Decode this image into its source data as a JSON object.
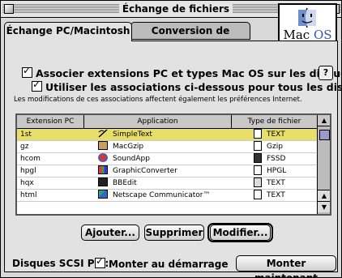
{
  "window": {
    "title": "Échange de fichiers"
  },
  "logo": {
    "text_mac": "Mac",
    "text_os": "OS"
  },
  "tabs": [
    {
      "label": "Échange PC/Macintosh",
      "active": true
    },
    {
      "label": "Conversion de fichiers",
      "active": false
    }
  ],
  "options": {
    "assoc_label": "Associer extensions PC et types Mac OS sur les disques PC",
    "assoc_checked": true,
    "use_label": "Utiliser les associations ci-dessous pour tous les disques",
    "use_checked": true,
    "help_label": "?"
  },
  "info_text": "Les modifications de ces associations affectent également les préférences Internet.",
  "table": {
    "columns": [
      "Extension PC",
      "Application",
      "Type de fichier"
    ],
    "rows": [
      {
        "ext": "1st",
        "app": "SimpleText",
        "type": "TEXT",
        "app_icon": "simpletext-icon",
        "type_icon": "text-document-icon",
        "selected": true
      },
      {
        "ext": "gz",
        "app": "MacGzip",
        "type": "Gzip",
        "app_icon": "macgzip-icon",
        "type_icon": "blank-document-icon",
        "selected": false
      },
      {
        "ext": "hcom",
        "app": "SoundApp",
        "type": "FSSD",
        "app_icon": "soundapp-icon",
        "type_icon": "sound-document-icon",
        "selected": false
      },
      {
        "ext": "hpgl",
        "app": "GraphicConverter",
        "type": "HPGL",
        "app_icon": "graphicconverter-icon",
        "type_icon": "blank-document-icon",
        "selected": false
      },
      {
        "ext": "hqx",
        "app": "BBEdit",
        "type": "TEXT",
        "app_icon": "bbedit-icon",
        "type_icon": "bbedit-document-icon",
        "selected": false
      },
      {
        "ext": "html",
        "app": "Netscape Communicator™",
        "type": "TEXT",
        "app_icon": "netscape-icon",
        "type_icon": "text-document-icon",
        "selected": false
      }
    ]
  },
  "buttons": {
    "add": "Ajouter...",
    "delete": "Supprimer",
    "modify": "Modifier..."
  },
  "scsi": {
    "label": "Disques SCSI PC :",
    "mount_label": "Monter au démarrage",
    "mount_checked": true,
    "mount_now": "Monter maintenant"
  },
  "colors": {
    "selection": "#e8df6a",
    "scroll_thumb": "#9a9acb",
    "window_bg": "#d8d8d8"
  }
}
